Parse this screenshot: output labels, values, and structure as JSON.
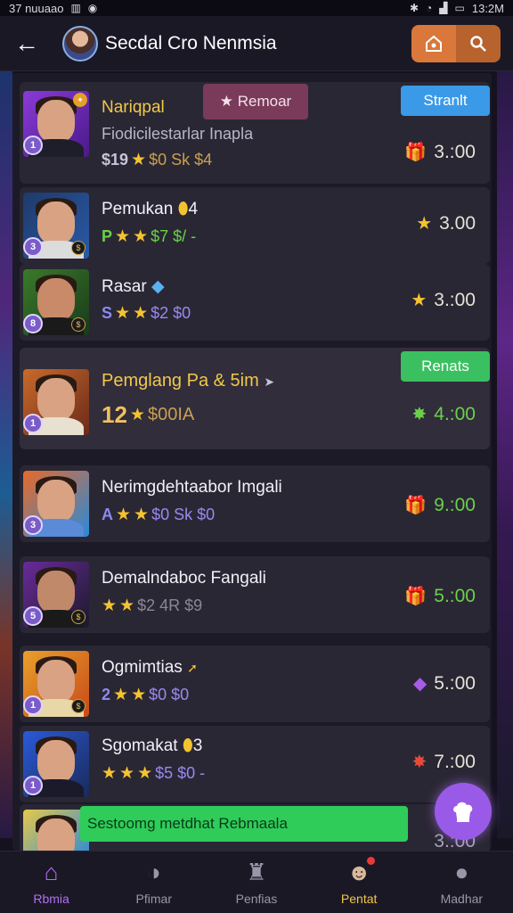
{
  "status_bar": {
    "left": "37 nuuaao",
    "right": "13:2M"
  },
  "header": {
    "title": "Secdal Cro Nenmsia"
  },
  "rows": [
    {
      "name": "Nariqpal",
      "sub": "Fiodicilestarlar Inapla",
      "lead": "$19",
      "cost": "$0 Sk $4",
      "price": "3.:00",
      "price_icon": "gift-icon",
      "level": "1",
      "tag_left": "Remoar",
      "tag_right": "Stranlt"
    },
    {
      "name": "Pemukan",
      "suffix": "4",
      "lead": "P",
      "cost": "$7 $/ -",
      "price": "3.00",
      "level": "3"
    },
    {
      "name": "Rasar",
      "lead": "S",
      "cost": "$2 $0",
      "price": "3.:00",
      "level": "8"
    },
    {
      "name": "Pemglang Pa & 5im",
      "lead": "12",
      "cost": "$00IA",
      "price": "4.:00",
      "level": "1",
      "tag_right": "Renats"
    },
    {
      "name": "Nerimgdehtaabor Imgali",
      "lead": "A",
      "cost": "$0 Sk $0",
      "price": "9.:00",
      "level": "3"
    },
    {
      "name": "Demalndaboc Fangali",
      "lead": "",
      "cost": "$2 4R $9",
      "price": "5.:00",
      "level": "5"
    },
    {
      "name": "Ogmimtias",
      "lead": "2",
      "cost": "$0 $0",
      "price": "5.:00",
      "level": "1"
    },
    {
      "name": "Sgomakat",
      "suffix": "3",
      "lead": "",
      "cost": "$5 $0 -",
      "price": "7.:00",
      "level": "1"
    },
    {
      "name": "",
      "price": "3.:00"
    }
  ],
  "toast": "Sestoomg metdhat Rebmaala",
  "bottom_nav": [
    {
      "label": "Rbmia",
      "icon": "home-icon"
    },
    {
      "label": "Pfimar",
      "icon": "compass-icon"
    },
    {
      "label": "Penfias",
      "icon": "trophy-icon"
    },
    {
      "label": "Pentat",
      "icon": "chat-icon"
    },
    {
      "label": "Madhar",
      "icon": "profile-icon"
    }
  ]
}
